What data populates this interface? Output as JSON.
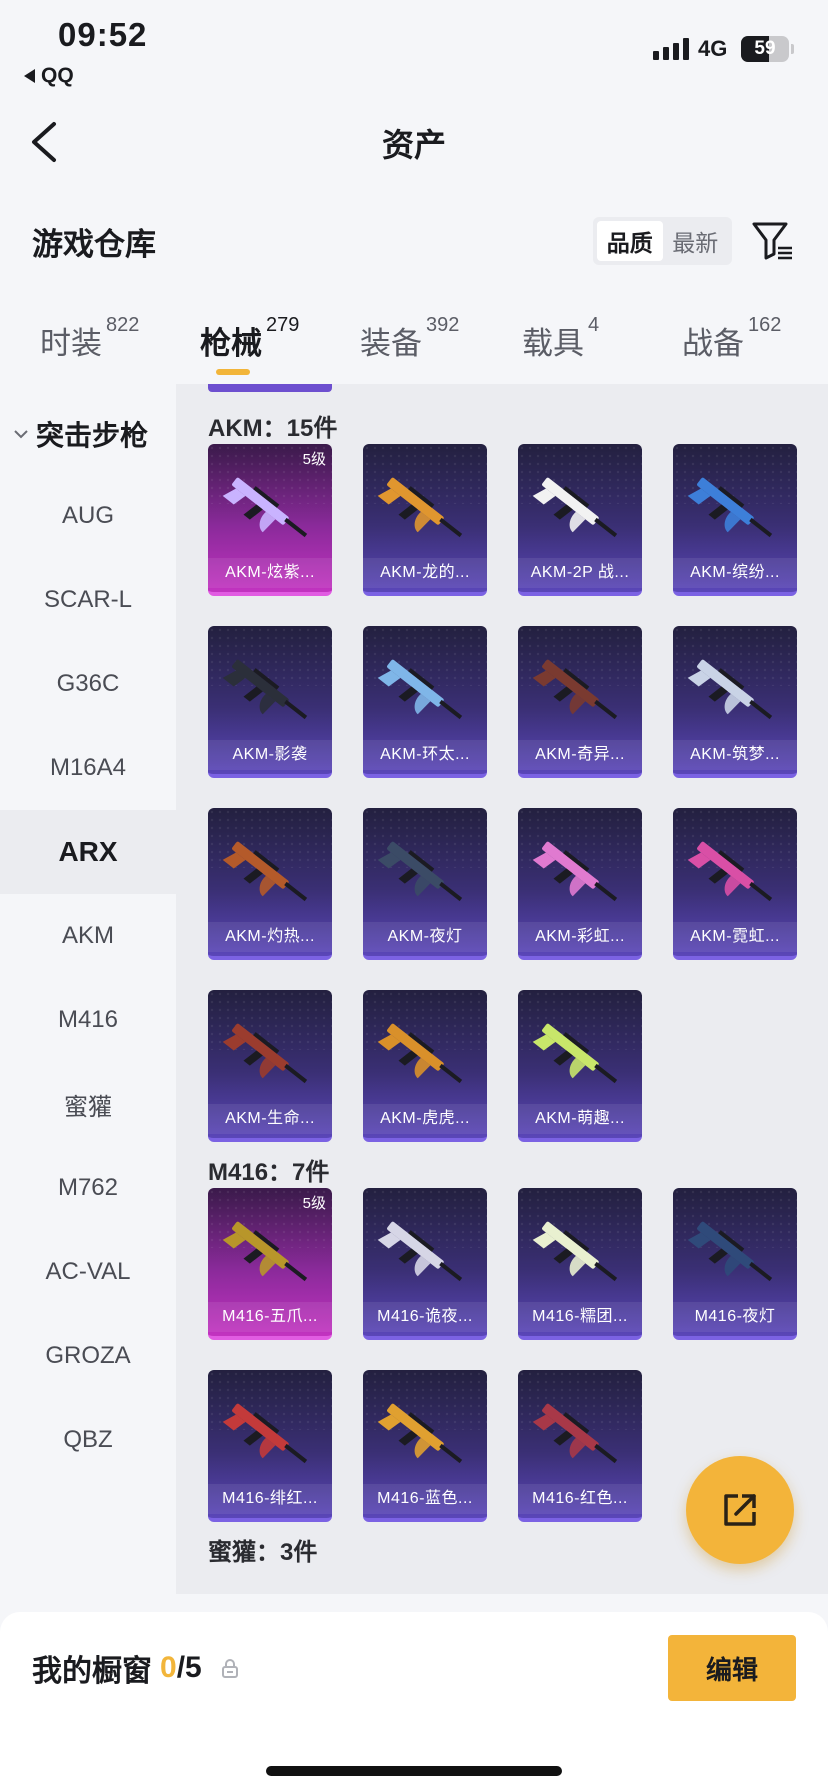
{
  "status": {
    "time": "09:52",
    "back_app": "QQ",
    "network": "4G",
    "battery": "59",
    "battery_level": 0.59
  },
  "nav": {
    "title": "资产"
  },
  "section": {
    "title": "游戏仓库",
    "sort_options": [
      "品质",
      "最新"
    ],
    "sort_selected": "品质"
  },
  "tabs": [
    {
      "label": "时装",
      "count": "822"
    },
    {
      "label": "枪械",
      "count": "279"
    },
    {
      "label": "装备",
      "count": "392"
    },
    {
      "label": "载具",
      "count": "4"
    },
    {
      "label": "战备",
      "count": "162"
    }
  ],
  "active_tab": "枪械",
  "sidebar": {
    "category": "突击步枪",
    "items": [
      "AUG",
      "SCAR-L",
      "G36C",
      "M16A4",
      "ARX",
      "AKM",
      "M416",
      "蜜獾",
      "M762",
      "AC-VAL",
      "GROZA",
      "QBZ"
    ],
    "active": "ARX"
  },
  "groups": [
    {
      "header": "AKM：15件",
      "items": [
        {
          "name": "AKM-炫紫...",
          "level": "5级",
          "rarity": "legendary",
          "color": "#c9b3ff"
        },
        {
          "name": "AKM-龙的...",
          "rarity": "epic",
          "color": "#e0962f"
        },
        {
          "name": "AKM-2P 战...",
          "rarity": "epic",
          "color": "#f2f2f2"
        },
        {
          "name": "AKM-缤纷...",
          "rarity": "epic",
          "color": "#3d7fd9"
        },
        {
          "name": "AKM-影袭",
          "rarity": "epic",
          "color": "#2b2f3a"
        },
        {
          "name": "AKM-环太...",
          "rarity": "epic",
          "color": "#7fb6e8"
        },
        {
          "name": "AKM-奇异...",
          "rarity": "epic",
          "color": "#7a3a30"
        },
        {
          "name": "AKM-筑梦...",
          "rarity": "epic",
          "color": "#c9d3e6"
        },
        {
          "name": "AKM-灼热...",
          "rarity": "epic",
          "color": "#b45a2a"
        },
        {
          "name": "AKM-夜灯",
          "rarity": "epic",
          "color": "#3b4b66"
        },
        {
          "name": "AKM-彩虹...",
          "rarity": "epic",
          "color": "#e07ad0"
        },
        {
          "name": "AKM-霓虹...",
          "rarity": "epic",
          "color": "#d94fa6"
        },
        {
          "name": "AKM-生命...",
          "rarity": "epic",
          "color": "#9b3c2e"
        },
        {
          "name": "AKM-虎虎...",
          "rarity": "epic",
          "color": "#d9902a"
        },
        {
          "name": "AKM-萌趣...",
          "rarity": "epic",
          "color": "#c8e66a"
        }
      ]
    },
    {
      "header": "M416：7件",
      "items": [
        {
          "name": "M416-五爪...",
          "level": "5级",
          "rarity": "legendary",
          "color": "#b8962a"
        },
        {
          "name": "M416-诡夜...",
          "rarity": "epic",
          "color": "#d6d6e6"
        },
        {
          "name": "M416-糯团...",
          "rarity": "epic",
          "color": "#e9f0d0"
        },
        {
          "name": "M416-夜灯",
          "rarity": "epic",
          "color": "#2f4a7a"
        },
        {
          "name": "M416-绯红...",
          "rarity": "epic",
          "color": "#c33a3a"
        },
        {
          "name": "M416-蓝色...",
          "rarity": "epic",
          "color": "#e0a030"
        },
        {
          "name": "M416-红色...",
          "rarity": "epic",
          "color": "#a83848"
        }
      ]
    },
    {
      "header": "蜜獾：3件",
      "items": []
    }
  ],
  "showcase": {
    "label": "我的橱窗",
    "current": "0",
    "total": "/5",
    "edit_label": "编辑"
  },
  "colors": {
    "accent": "#f3b43a",
    "card_purple": "#5a46b8",
    "card_legendary": "#c233c0"
  },
  "icons": {
    "nav_back": "chevron-left-icon",
    "filter": "filter-icon",
    "share": "share-external-icon",
    "lock": "lock-icon",
    "expand": "chevron-down-icon"
  }
}
